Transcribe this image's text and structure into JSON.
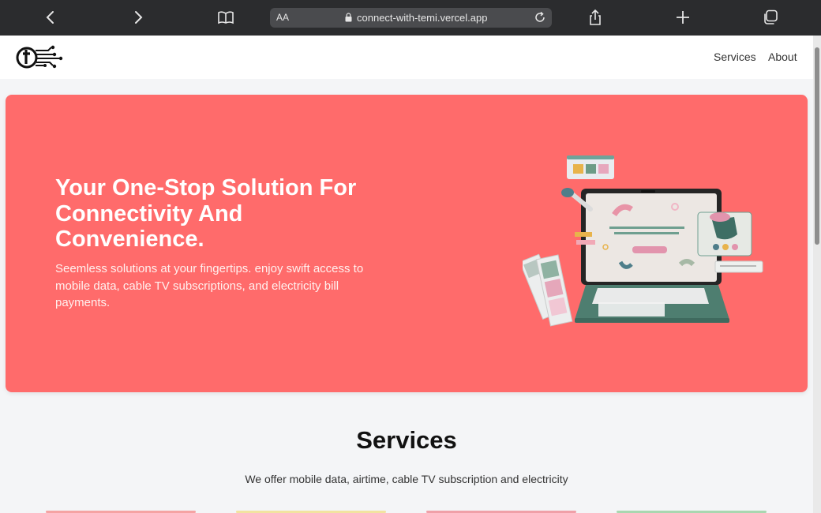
{
  "browser": {
    "aa_label": "AA",
    "url": "connect-with-temi.vercel.app",
    "icons": [
      "back-icon",
      "forward-icon",
      "book-icon",
      "lock-icon",
      "reload-icon",
      "share-icon",
      "plus-icon",
      "tabs-icon"
    ]
  },
  "header": {
    "nav": {
      "services": "Services",
      "about": "About"
    }
  },
  "hero": {
    "title": "Your One-Stop Solution For Connectivity And Convenience.",
    "subtitle": "Seemless solutions at your fingertips. enjoy swift access to mobile data, cable TV subscriptions, and electricity bill payments.",
    "background": "#ff6b6b"
  },
  "services": {
    "title": "Services",
    "description": "We offer mobile data, airtime, cable TV subscription and electricity",
    "card_colors": [
      "#f5a3a3",
      "#f2e3a0",
      "#f0a0a8",
      "#a9d7b0"
    ]
  }
}
